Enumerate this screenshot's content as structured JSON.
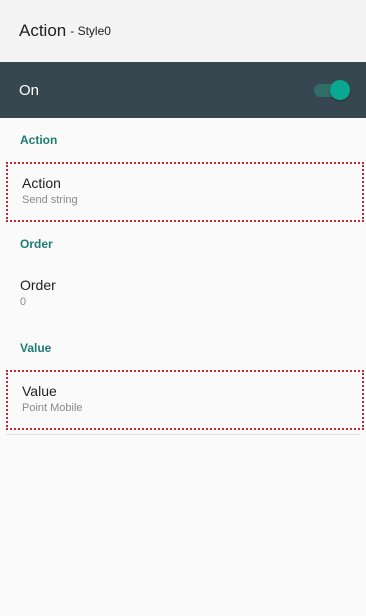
{
  "header": {
    "title": "Action",
    "subtitle": "- Style0"
  },
  "master_switch": {
    "label": "On",
    "state": "on",
    "accent_color": "#0aa891"
  },
  "sections": [
    {
      "header": "Action",
      "item": {
        "title": "Action",
        "summary": "Send string"
      }
    },
    {
      "header": "Order",
      "item": {
        "title": "Order",
        "summary": "0"
      }
    },
    {
      "header": "Value",
      "item": {
        "title": "Value",
        "summary": "Point Mobile"
      }
    }
  ],
  "colors": {
    "switch_bar": "#37474f",
    "section_header": "#1d7c74",
    "highlight_outline": "#c62828"
  }
}
